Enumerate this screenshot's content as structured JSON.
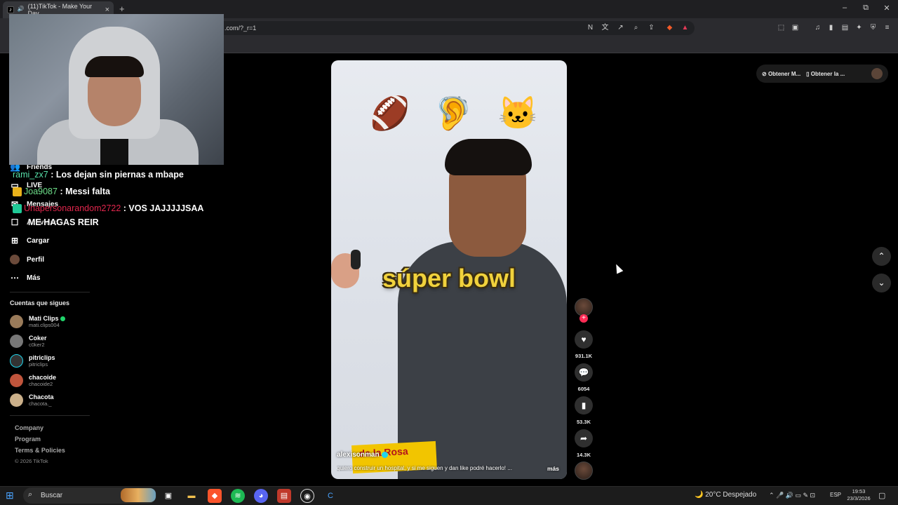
{
  "browser": {
    "tab_title": "(11)TikTok - Make Your Day",
    "tab_favicon": "tiktok-icon",
    "url_fragment": ".com/?_r=1",
    "new_tab": "+",
    "window_min": "–",
    "window_restore": "⧉",
    "window_close": "✕"
  },
  "chat": [
    {
      "user": "rami_zx7",
      "message": ": Los dejan sin piernas a mbape"
    },
    {
      "user": "Joa9087",
      "message": ": Messi falta"
    },
    {
      "user": "Unapersonarandom2722",
      "message": ": VOS JAJJJJJSAA"
    },
    {
      "user": "",
      "message": "ME HAGAS REIR"
    }
  ],
  "sidebar": {
    "items": [
      {
        "label": "Friends",
        "icon": "friends-icon"
      },
      {
        "label": "LIVE",
        "icon": "live-icon"
      },
      {
        "label": "Mensajes",
        "icon": "messages-icon",
        "badge": "1"
      },
      {
        "label": "Actividad",
        "icon": "activity-icon"
      },
      {
        "label": "Cargar",
        "icon": "upload-icon"
      },
      {
        "label": "Perfil",
        "icon": "profile-icon"
      },
      {
        "label": "Más",
        "icon": "more-icon"
      }
    ],
    "following_heading": "Cuentas que sigues",
    "accounts": [
      {
        "name": "Mati Clips",
        "handle": "mati.clips004",
        "online": true,
        "color": "#9a7b5a"
      },
      {
        "name": "Coker",
        "handle": "c0ker2",
        "online": false,
        "color": "#777"
      },
      {
        "name": "pitriclips",
        "handle": "pitriclips",
        "online": false,
        "color": "#333"
      },
      {
        "name": "chacoide",
        "handle": "chacoide2",
        "online": false,
        "color": "#c0553c"
      },
      {
        "name": "Chacota",
        "handle": "chacota._",
        "online": false,
        "color": "#cbb08a"
      }
    ],
    "footer": [
      "Company",
      "Program",
      "Terms & Policies"
    ],
    "copyright": "© 2026 TikTok"
  },
  "video": {
    "emojis": [
      "🏈",
      "🦻",
      "🐱"
    ],
    "caption": "súper bowl",
    "author": "alexisonman",
    "description": "quiero construir un hospital, y si me siguen y dan like podré hacerlo! ...",
    "more": "más",
    "snack_text": "de la Rosa"
  },
  "actions": {
    "likes": "931.1K",
    "comments": "6054",
    "saves": "53.3K",
    "shares": "14.3K"
  },
  "top_pill": {
    "item1": "Obtener M...",
    "item2": "Obtener la ..."
  },
  "taskbar": {
    "search_placeholder": "Buscar",
    "weather_temp": "20°C",
    "weather_desc": "Despejado",
    "lang": "ESP",
    "time": "19:53",
    "date": "23/3/2026"
  }
}
